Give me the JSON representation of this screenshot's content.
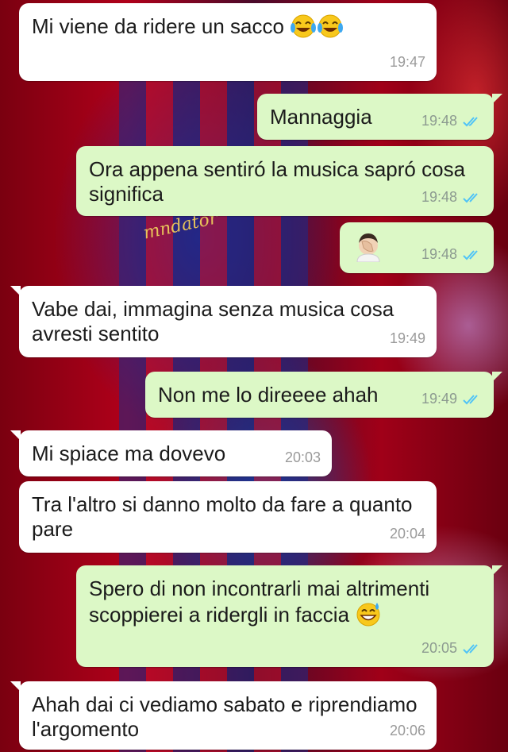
{
  "messages": [
    {
      "direction": "in",
      "text": "Mi viene da ridere un sacco",
      "emoji": [
        "tears-of-joy",
        "tears-of-joy"
      ],
      "time": "19:47"
    },
    {
      "direction": "out",
      "text": "Mannaggia",
      "time": "19:48",
      "status": "read"
    },
    {
      "direction": "out",
      "text": "Ora appena sentiró la musica sapró cosa significa",
      "time": "19:48",
      "status": "read"
    },
    {
      "direction": "out",
      "text": "",
      "emoji": [
        "facepalm"
      ],
      "time": "19:48",
      "status": "read"
    },
    {
      "direction": "in",
      "text": "Vabe dai, immagina senza musica cosa avresti sentito",
      "time": "19:49"
    },
    {
      "direction": "out",
      "text": "Non me lo direeee ahah",
      "time": "19:49",
      "status": "read"
    },
    {
      "direction": "in",
      "text": "Mi spiace ma dovevo",
      "time": "20:03"
    },
    {
      "direction": "in",
      "text": "Tra l'altro si danno molto da fare a quanto pare",
      "time": "20:04"
    },
    {
      "direction": "out",
      "text": "Spero di non incontrarli mai altrimenti scoppierei a ridergli in faccia",
      "emoji": [
        "grinning-sweat"
      ],
      "time": "20:05",
      "status": "read"
    },
    {
      "direction": "in",
      "text": "Ahah dai ci vediamo sabato e riprendiamo l'argomento",
      "time": "20:06"
    }
  ],
  "colors": {
    "incoming_bubble": "#ffffff",
    "outgoing_bubble": "#dcf8c6",
    "read_ticks": "#4fc3f7"
  },
  "wallpaper": {
    "jersey_text": "mndator"
  }
}
